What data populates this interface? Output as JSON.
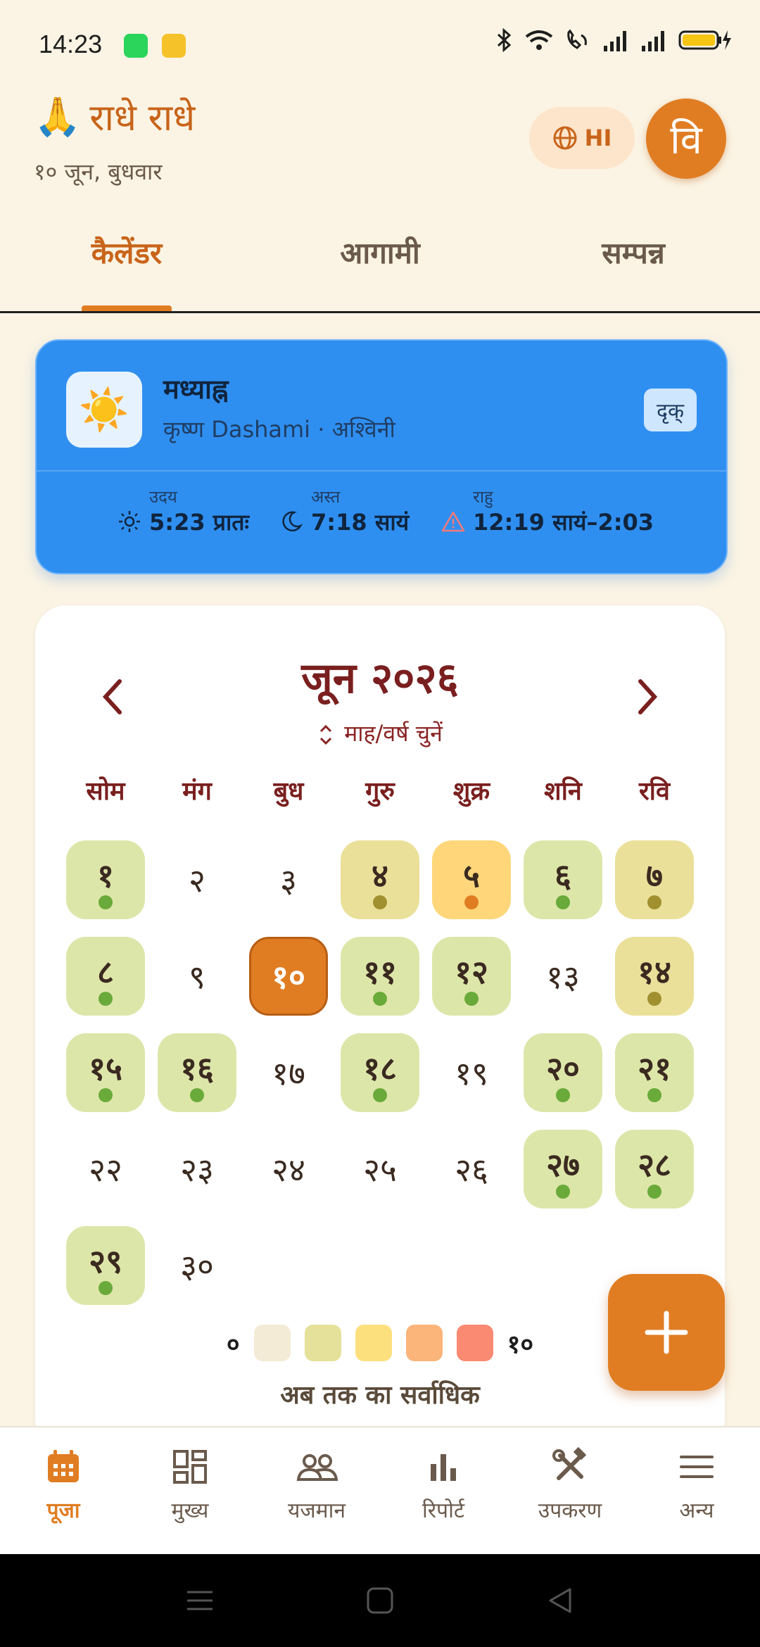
{
  "status_bar": {
    "time": "14:23"
  },
  "header": {
    "greeting": "राधे राधे",
    "greeting_emoji": "🙏",
    "date": "१० जून, बुधवार",
    "language_button": "HI",
    "avatar_letter": "वि"
  },
  "tabs": [
    "कैलेंडर",
    "आगामी",
    "सम्पन्न"
  ],
  "panchang": {
    "sun_icon": "☀️",
    "title": "मध्याह्न",
    "subtitle": "कृष्ण Dashami · अश्विनी",
    "badge": "दृक्",
    "items": [
      {
        "label": "उदय",
        "value": "5:23 प्रातः",
        "icon": "sunrise-icon"
      },
      {
        "label": "अस्त",
        "value": "7:18 सायं",
        "icon": "moon-icon"
      },
      {
        "label": "राहु",
        "value": "12:19 सायं–2:03",
        "icon": "warning-icon"
      }
    ]
  },
  "calendar": {
    "month_title": "जून २०२६",
    "select_label": "माह/वर्ष चुनें",
    "weekdays": [
      "सोम",
      "मंग",
      "बुध",
      "गुरु",
      "शुक्र",
      "शनि",
      "रवि"
    ],
    "days": [
      {
        "label": "१",
        "level": "green"
      },
      {
        "label": "२",
        "level": "none"
      },
      {
        "label": "३",
        "level": "none"
      },
      {
        "label": "४",
        "level": "olive"
      },
      {
        "label": "५",
        "level": "yellow"
      },
      {
        "label": "६",
        "level": "green"
      },
      {
        "label": "७",
        "level": "olive"
      },
      {
        "label": "८",
        "level": "green"
      },
      {
        "label": "९",
        "level": "none"
      },
      {
        "label": "१०",
        "level": "today"
      },
      {
        "label": "११",
        "level": "green"
      },
      {
        "label": "१२",
        "level": "green"
      },
      {
        "label": "१३",
        "level": "none"
      },
      {
        "label": "१४",
        "level": "olive"
      },
      {
        "label": "१५",
        "level": "green"
      },
      {
        "label": "१६",
        "level": "green"
      },
      {
        "label": "१७",
        "level": "none"
      },
      {
        "label": "१८",
        "level": "green"
      },
      {
        "label": "१९",
        "level": "none"
      },
      {
        "label": "२०",
        "level": "green"
      },
      {
        "label": "२१",
        "level": "green"
      },
      {
        "label": "२२",
        "level": "none"
      },
      {
        "label": "२३",
        "level": "none"
      },
      {
        "label": "२४",
        "level": "none"
      },
      {
        "label": "२५",
        "level": "none"
      },
      {
        "label": "२६",
        "level": "none"
      },
      {
        "label": "२७",
        "level": "green"
      },
      {
        "label": "२८",
        "level": "green"
      },
      {
        "label": "२९",
        "level": "green"
      },
      {
        "label": "३०",
        "level": "none"
      }
    ],
    "legend_min": "०",
    "legend_max": "१०",
    "legend_colors": [
      "#f4ebd6",
      "#e6e19a",
      "#fde07e",
      "#fbb47a",
      "#fa8a72"
    ],
    "legend_caption": "अब तक का सर्वाधिक"
  },
  "fab": {
    "icon": "plus-icon"
  },
  "bottom_nav": [
    {
      "label": "पूजा",
      "icon": "calendar-icon",
      "active": true
    },
    {
      "label": "मुख्य",
      "icon": "dashboard-icon",
      "active": false
    },
    {
      "label": "यजमान",
      "icon": "people-icon",
      "active": false
    },
    {
      "label": "रिपोर्ट",
      "icon": "bar-chart-icon",
      "active": false
    },
    {
      "label": "उपकरण",
      "icon": "tools-icon",
      "active": false
    },
    {
      "label": "अन्य",
      "icon": "menu-icon",
      "active": false
    }
  ],
  "colors": {
    "accent": "#e07d23",
    "maroon": "#7a1f1f",
    "panchang_blue": "#2f8ff0"
  }
}
